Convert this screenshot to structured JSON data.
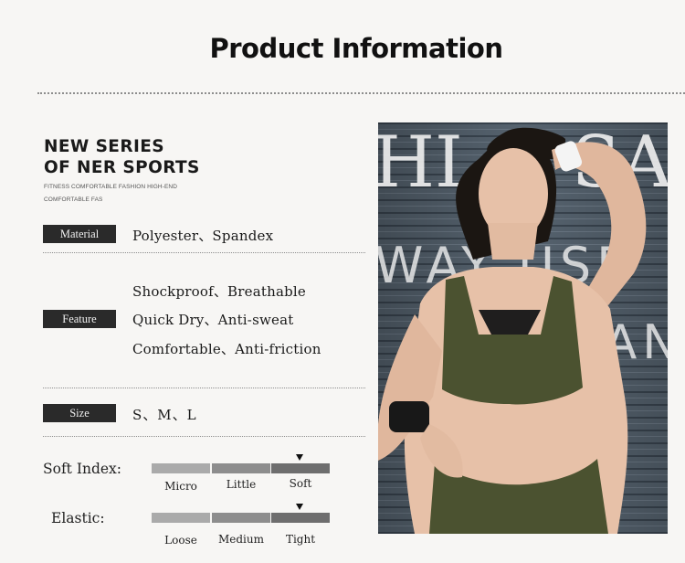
{
  "header": {
    "title": "Product Information"
  },
  "brand": {
    "line1": "NEW SERIES",
    "line2": "OF NER SPORTS",
    "sub": "FITNESS COMFORTABLE FASHION HIGH-END COMFORTABLE FAS"
  },
  "specs": {
    "material": {
      "label": "Material",
      "value": "Polyester、Spandex"
    },
    "feature": {
      "label": "Feature",
      "values": [
        "Shockproof、Breathable",
        "Quick Dry、Anti-sweat",
        "Comfortable、Anti-friction"
      ]
    },
    "size": {
      "label": "Size",
      "value": "S、M、L"
    }
  },
  "indices": {
    "soft": {
      "label": "Soft Index:",
      "levels": [
        "Micro",
        "Little",
        "Soft"
      ],
      "selected": "Soft"
    },
    "elastic": {
      "label": "Elastic:",
      "levels": [
        "Loose",
        "Medium",
        "Tight"
      ],
      "selected": "Tight"
    }
  },
  "photo": {
    "backdrop_text_rows": [
      "HI  &  SA",
      "WAY  USE",
      "STAN"
    ],
    "colors": {
      "top": "#4b5230",
      "skin": "#e7c1a8",
      "hair": "#1b1612",
      "wall": "#4d5a66"
    }
  }
}
